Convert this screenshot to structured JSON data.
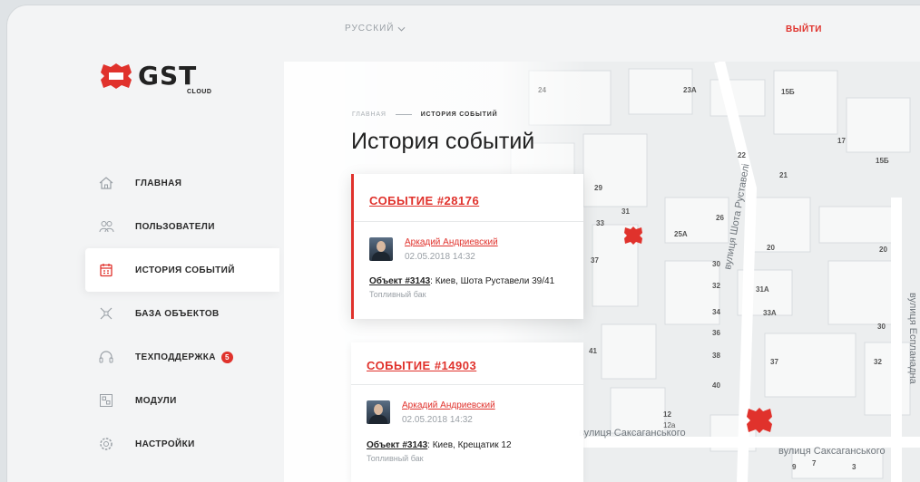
{
  "topbar": {
    "language": "РУССКИЙ",
    "logout": "ВЫЙТИ"
  },
  "logo": {
    "word": "GST",
    "sub": "CLOUD"
  },
  "nav": {
    "items": [
      {
        "label": "ГЛАВНАЯ"
      },
      {
        "label": "ПОЛЬЗОВАТЕЛИ"
      },
      {
        "label": "ИСТОРИЯ СОБЫТИЙ"
      },
      {
        "label": "БАЗА ОБЪЕКТОВ"
      },
      {
        "label": "ТЕХПОДДЕРЖКА",
        "badge": "5"
      },
      {
        "label": "МОДУЛИ"
      },
      {
        "label": "НАСТРОЙКИ"
      }
    ]
  },
  "breadcrumb": {
    "home": "ГЛАВНАЯ",
    "current": "ИСТОРИЯ СОБЫТИЙ"
  },
  "page": {
    "title": "История событий"
  },
  "events": [
    {
      "title": "СОБЫТИЕ #28176",
      "user": "Аркадий Андриевский",
      "date": "02.05.2018 14:32",
      "object_link": "Объект #3143",
      "address": ": Киев, Шота Руставели 39/41",
      "sensor": "Топливный бак"
    },
    {
      "title": "СОБЫТИЕ #14903",
      "user": "Аркадий Андриевский",
      "date": "02.05.2018 14:32",
      "object_link": "Объект #3143",
      "address": ": Киев, Крещатик 12",
      "sensor": "Топливный бак"
    }
  ],
  "map": {
    "streets": [
      "вулиця Шота Руставелі",
      "вулиця Саксаганського",
      "вулиця Саксаганського",
      "вулиця Еспланадна"
    ],
    "house_numbers": [
      "24",
      "23А",
      "15Б",
      "17",
      "22",
      "21",
      "15Б",
      "20",
      "29",
      "31",
      "33",
      "37",
      "26",
      "25А",
      "30",
      "32",
      "34",
      "36",
      "38",
      "40",
      "12",
      "31А",
      "33А",
      "37",
      "32",
      "30",
      "20",
      "21",
      "7",
      "9",
      "3",
      "41",
      "12а"
    ]
  },
  "colors": {
    "accent": "#e0322c",
    "text": "#222222",
    "muted": "#9aa0a6"
  }
}
